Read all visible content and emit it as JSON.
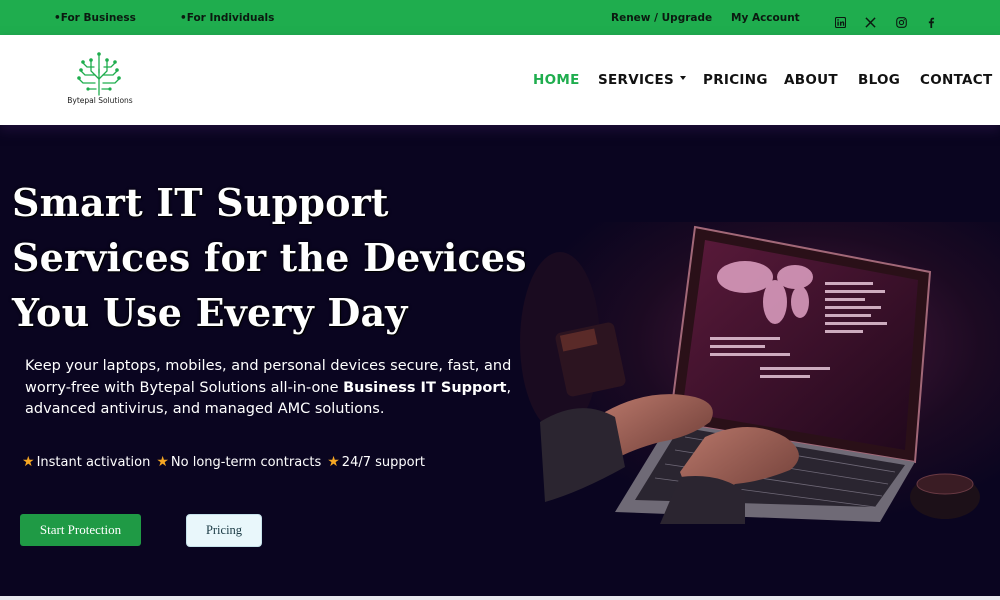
{
  "topbar": {
    "for_business": "•For Business",
    "for_individuals": "•For Individuals",
    "renew": "Renew / Upgrade",
    "account": "My Account",
    "social": [
      "linkedin-icon",
      "x-icon",
      "instagram-icon",
      "facebook-icon"
    ]
  },
  "brand": {
    "name": "Bytepal Solutions"
  },
  "nav": {
    "home": "HOME",
    "services": "SERVICES",
    "pricing": "PRICING",
    "about": "ABOUT",
    "blog": "BLOG",
    "contact": "CONTACT"
  },
  "hero": {
    "title_lines": [
      "Smart IT Support",
      "Services for the Devices",
      "You Use Every Day"
    ],
    "desc_1": "Keep your laptops, mobiles, and personal devices secure, fast, and worry-free with Bytepal Solutions all-in-one ",
    "desc_bold": "Business IT Support",
    "desc_2": ", advanced antivirus, and managed AMC solutions.",
    "features": [
      "Instant activation",
      "No long-term contracts",
      "24/7 support"
    ],
    "cta_primary": "Start Protection",
    "cta_secondary": "Pricing"
  },
  "colors": {
    "brand_green": "#1fad4e",
    "hero_bg": "#0a0520",
    "star": "#f5a623"
  }
}
